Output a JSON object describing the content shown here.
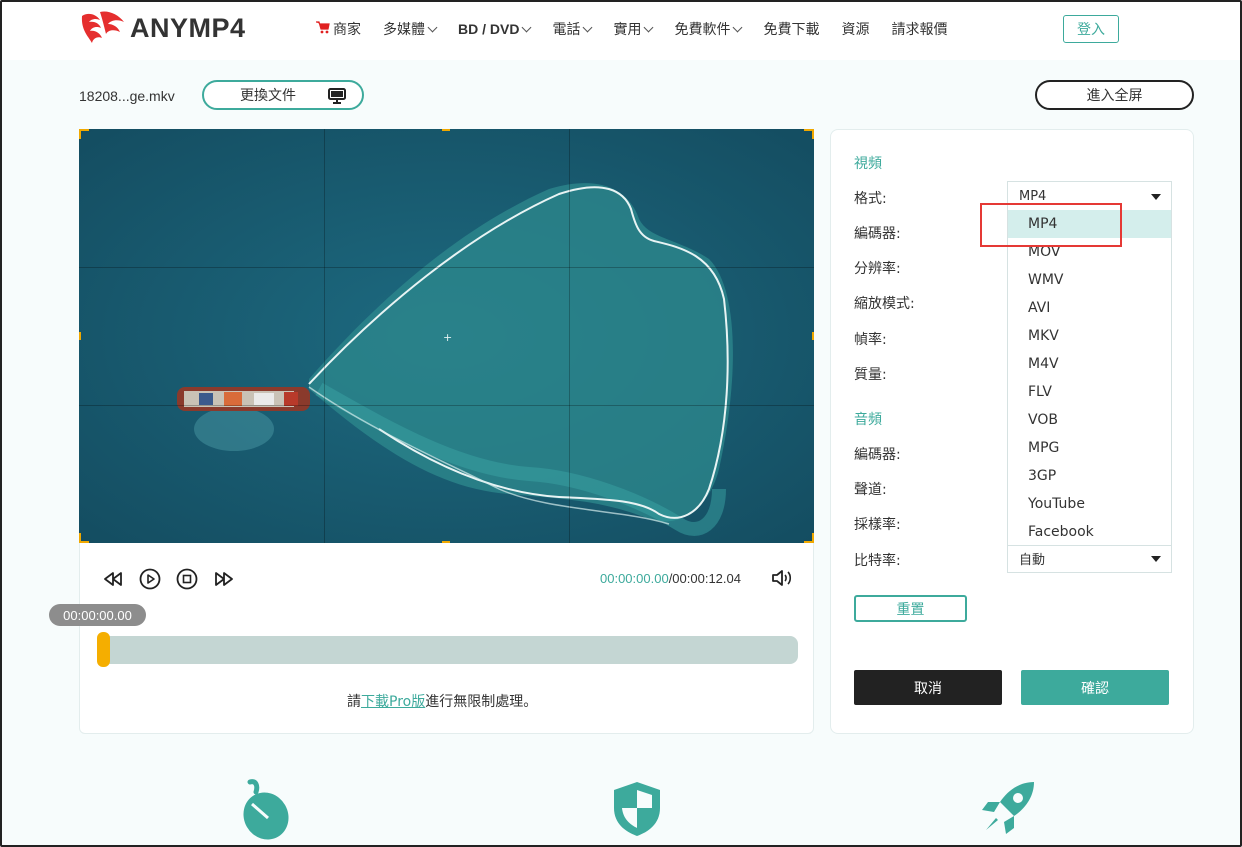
{
  "header": {
    "brand": "ANYMP4",
    "nav": [
      {
        "label": "商家",
        "chevron": false,
        "bold": false
      },
      {
        "label": "多媒體",
        "chevron": true,
        "bold": false
      },
      {
        "label": "BD / DVD",
        "chevron": true,
        "bold": true
      },
      {
        "label": "電話",
        "chevron": true,
        "bold": false
      },
      {
        "label": "實用",
        "chevron": true,
        "bold": false
      },
      {
        "label": "免費軟件",
        "chevron": true,
        "bold": false
      },
      {
        "label": "免費下載",
        "chevron": false,
        "bold": false
      },
      {
        "label": "資源",
        "chevron": false,
        "bold": false
      },
      {
        "label": "請求報價",
        "chevron": false,
        "bold": false
      }
    ],
    "login_label": "登入"
  },
  "toolbar": {
    "filename": "18208...ge.mkv",
    "change_file_label": "更換文件",
    "fullscreen_label": "進入全屏"
  },
  "player": {
    "current_time": "00:00:00.00",
    "total_time": "/00:00:12.04",
    "bubble_time": "00:00:00.00",
    "progress": 0,
    "note_prefix": "請",
    "note_link": "下載Pro版",
    "note_suffix": "進行無限制處理。"
  },
  "settings": {
    "video_title": "視頻",
    "audio_title": "音頻",
    "video_labels": {
      "format": "格式:",
      "encoder": "編碼器:",
      "resolution": "分辨率:",
      "zoom": "縮放模式:",
      "framerate": "幀率:",
      "quality": "質量:"
    },
    "audio_labels": {
      "encoder": "編碼器:",
      "channel": "聲道:",
      "samplerate": "採樣率:",
      "bitrate": "比特率:"
    },
    "format_value": "MP4",
    "bitrate_value": "自動",
    "format_options": [
      "MP4",
      "MOV",
      "WMV",
      "AVI",
      "MKV",
      "M4V",
      "FLV",
      "VOB",
      "MPG",
      "3GP",
      "YouTube",
      "Facebook"
    ],
    "selected_option": "MP4",
    "reset_label": "重置",
    "cancel_label": "取消",
    "confirm_label": "確認"
  },
  "colors": {
    "accent": "#3daa9c",
    "handle": "#f5ae00",
    "highlight": "#e53935"
  }
}
